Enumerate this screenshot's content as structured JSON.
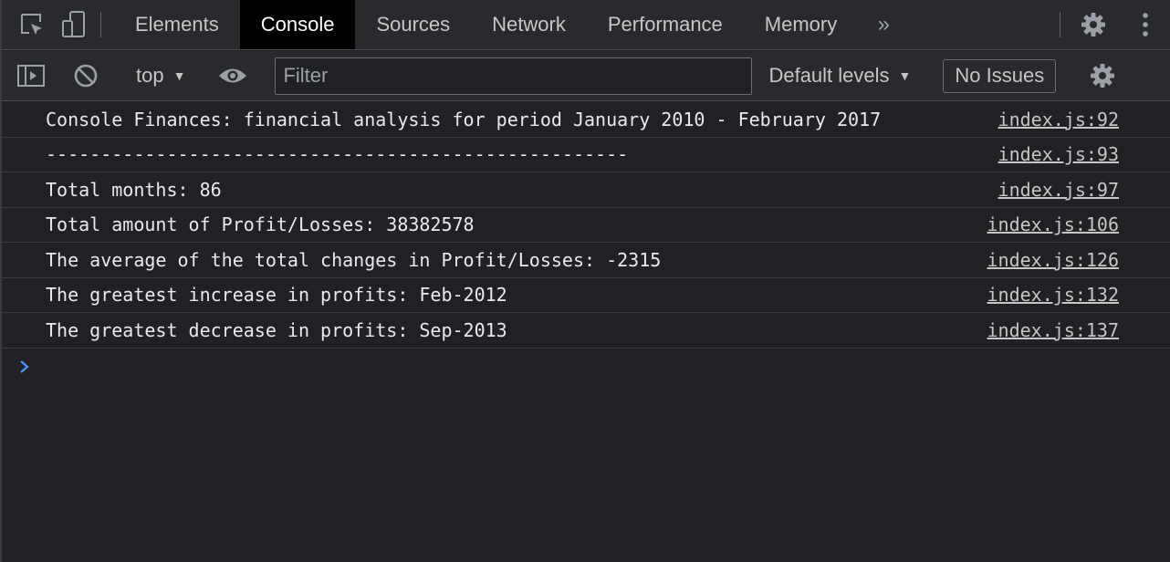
{
  "tabs": {
    "items": [
      "Elements",
      "Console",
      "Sources",
      "Network",
      "Performance",
      "Memory"
    ],
    "active": "Console",
    "more_label": "»"
  },
  "toolbar": {
    "context": "top",
    "filter_placeholder": "Filter",
    "levels": "Default levels",
    "issues": "No Issues"
  },
  "messages": [
    {
      "text": "Console Finances: financial analysis for period January 2010 - February 2017",
      "source": "index.js:92"
    },
    {
      "text": "-----------------------------------------------------",
      "source": "index.js:93"
    },
    {
      "text": "Total months: 86",
      "source": "index.js:97"
    },
    {
      "text": "Total amount of Profit/Losses: 38382578",
      "source": "index.js:106"
    },
    {
      "text": "The average of the total changes in Profit/Losses: -2315",
      "source": "index.js:126"
    },
    {
      "text": "The greatest increase in profits: Feb-2012",
      "source": "index.js:132"
    },
    {
      "text": "The greatest decrease in profits: Sep-2013",
      "source": "index.js:137"
    }
  ],
  "colors": {
    "background": "#202124",
    "toolbar": "#292a2d",
    "active_tab": "#000000",
    "prompt": "#4d8ff6"
  }
}
